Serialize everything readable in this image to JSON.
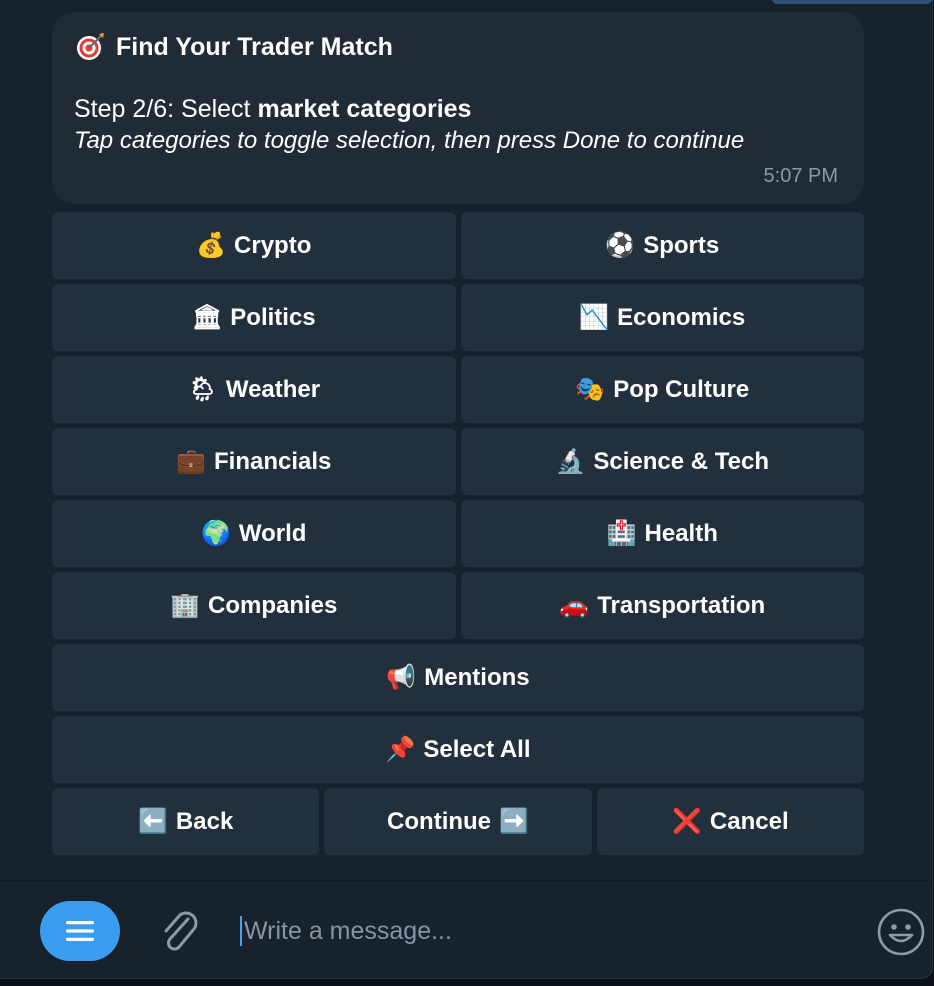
{
  "message": {
    "title_icon": "target-icon",
    "title": "Find Your Trader Match",
    "step_prefix": "Step 2/6: Select ",
    "step_bold": "market categories",
    "hint": "Tap categories to toggle selection, then press Done to continue",
    "time": "5:07 PM"
  },
  "keyboard": {
    "rows": [
      [
        {
          "emoji": "💰",
          "icon": "money-bag-icon",
          "label": "Crypto"
        },
        {
          "emoji": "⚽",
          "icon": "soccer-ball-icon",
          "label": "Sports"
        }
      ],
      [
        {
          "emoji": "🏛",
          "icon": "classical-building-icon",
          "label": "Politics"
        },
        {
          "emoji": "📉",
          "icon": "chart-decreasing-icon",
          "label": "Economics"
        }
      ],
      [
        {
          "emoji": "🌦",
          "icon": "sun-rain-cloud-icon",
          "label": "Weather"
        },
        {
          "emoji": "🎭",
          "icon": "theater-masks-icon",
          "label": "Pop Culture"
        }
      ],
      [
        {
          "emoji": "💼",
          "icon": "briefcase-icon",
          "label": "Financials"
        },
        {
          "emoji": "🔬",
          "icon": "microscope-icon",
          "label": "Science & Tech"
        }
      ],
      [
        {
          "emoji": "🌍",
          "icon": "globe-icon",
          "label": "World"
        },
        {
          "emoji": "🏥",
          "icon": "hospital-icon",
          "label": "Health"
        }
      ],
      [
        {
          "emoji": "🏢",
          "icon": "office-building-icon",
          "label": "Companies"
        },
        {
          "emoji": "🚗",
          "icon": "car-icon",
          "label": "Transportation"
        }
      ],
      [
        {
          "emoji": "📢",
          "icon": "loudspeaker-icon",
          "label": "Mentions"
        }
      ],
      [
        {
          "emoji": "📌",
          "icon": "pushpin-icon",
          "label": "Select All"
        }
      ],
      [
        {
          "emoji": "⬅️",
          "icon": "left-arrow-icon",
          "label": "Back"
        },
        {
          "emoji": "",
          "icon": "",
          "label": "Continue",
          "trail_emoji": "➡️",
          "trail_icon": "right-arrow-icon"
        },
        {
          "emoji": "❌",
          "icon": "cross-mark-icon",
          "label": "Cancel"
        }
      ]
    ]
  },
  "composer": {
    "placeholder": "Write a message...",
    "menu_icon": "menu-icon",
    "attach_icon": "paperclip-icon",
    "emoji_icon": "smiley-icon"
  },
  "colors": {
    "background": "#18222d",
    "bubble": "#202b36",
    "button": "#22303e",
    "accent": "#3a9df0",
    "muted_text": "#8a99a8"
  }
}
